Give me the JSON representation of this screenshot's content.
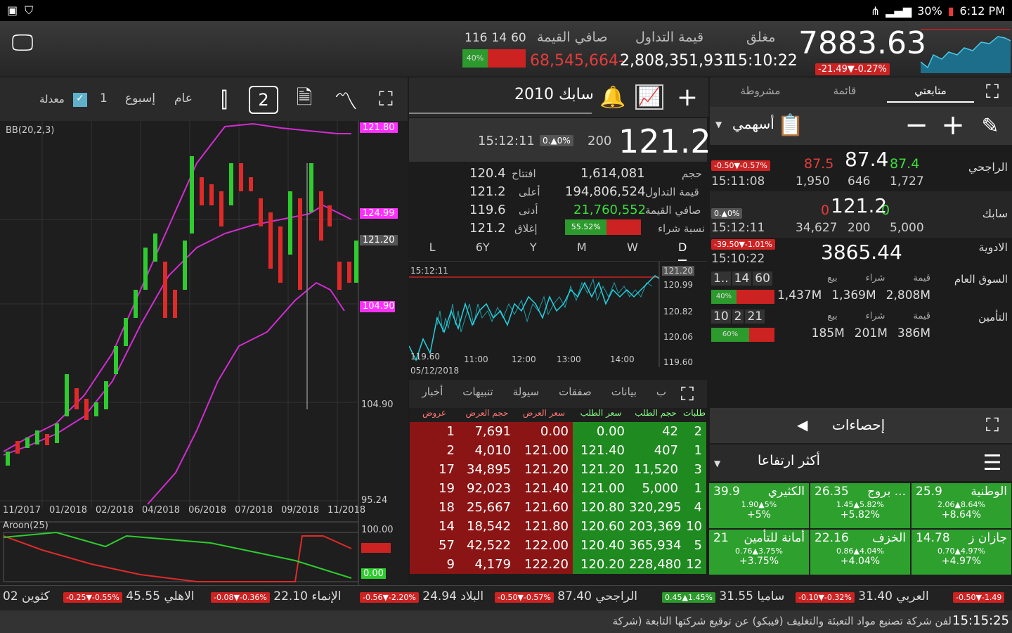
{
  "status": {
    "time": "6:12 PM",
    "battery": "30%"
  },
  "header": {
    "index_value": "7883.63",
    "index_change": "-21.49▼-0.27%",
    "labels": {
      "closed": "مغلق",
      "trade_value": "قيمة التداول",
      "net_value": "صافي القيمة"
    },
    "time": "15:10:22",
    "trade_value": "2,808,351,931",
    "net_value": "68,545,664-",
    "breadth": {
      "up": "116",
      "mid": "14",
      "down": "60",
      "pct": "40%"
    }
  },
  "chart_toolbar": {
    "adjusted": "معدلة",
    "period_n": "1",
    "period_week": "إسبوع",
    "period_year": "عام",
    "two": "2"
  },
  "main_chart": {
    "indicator": "BB(20,2,3)",
    "right_axis": [
      "121.80",
      "124.99",
      "121.20",
      "104.90",
      "95.24"
    ],
    "marker_low": "104.90 ",
    "x_labels": [
      "11/2017",
      "01/2018",
      "02/2018",
      "04/2018",
      "06/2018",
      "07/2018",
      "09/2018",
      "11/2018"
    ],
    "aroon": "Aroon(25)",
    "aroon_axis": [
      "100.00",
      "0.00"
    ]
  },
  "stock": {
    "title": "2010 سابك",
    "price": "121.2",
    "volume": "200",
    "change_badge": "0.▲0%",
    "time": "15:12:11",
    "labels": {
      "open": "افتتاح",
      "high": "أعلى",
      "low": "أدنى",
      "close": "إغلاق",
      "vol": "حجم",
      "tval": "قيمة التداول",
      "net": "صافي القيمة",
      "buy_pct": "نسبة شراء"
    },
    "open": "120.4",
    "high": "121.2",
    "low": "119.6",
    "close": "121.2",
    "vol": "1,614,081",
    "tval": "194,806,524",
    "net": "21,760,552",
    "buy_pct": "55.52%"
  },
  "intraday": {
    "periods": [
      "D",
      "W",
      "M",
      "Y",
      "6Y",
      "L"
    ],
    "time_label": "15:12:11",
    "date_label": "05/12/2018",
    "x_labels": [
      "11:00",
      "12:00",
      "13:00",
      "14:00"
    ],
    "y_labels": [
      "121.20",
      "120.99",
      "120.82",
      "120.06",
      "119.60"
    ],
    "left_low": "119.60"
  },
  "detail_tabs": [
    "ب",
    "بيانات",
    "صفقات",
    "سيولة",
    "تنبيهات",
    "أخبار"
  ],
  "orderbook": {
    "headers": [
      "طلبات",
      "حجم الطلب",
      "سعر الطلب",
      "سعر العرض",
      "حجم العرض",
      "عروض"
    ],
    "rows": [
      [
        "2",
        "42",
        "0.00",
        "0.00",
        "7,691",
        "1"
      ],
      [
        "1",
        "407",
        "121.40",
        "121.00",
        "4,010",
        "2"
      ],
      [
        "3",
        "11,520",
        "121.20",
        "121.20",
        "34,895",
        "17"
      ],
      [
        "1",
        "5,000",
        "121.00",
        "121.40",
        "92,023",
        "19"
      ],
      [
        "4",
        "320,295",
        "120.80",
        "121.60",
        "25,667",
        "18"
      ],
      [
        "10",
        "203,369",
        "120.60",
        "121.80",
        "18,542",
        "14"
      ],
      [
        "5",
        "365,934",
        "120.40",
        "122.00",
        "42,522",
        "57"
      ],
      [
        "12",
        "228,480",
        "120.20",
        "122.20",
        "4,179",
        "9"
      ]
    ]
  },
  "watch_tabs": [
    "متابعتي",
    "قائمة",
    "مشروطة"
  ],
  "watch_group": "أسهمي",
  "watch": [
    {
      "name": "الراجحي",
      "price": "87.4",
      "bid": "87.4",
      "ask": "87.5",
      "change": "-0.50▼-0.57%",
      "time": "15:11:08",
      "v1": "1,727",
      "v2": "646",
      "v3": "1,950"
    },
    {
      "name": "سابك",
      "price": "121.2",
      "bid": "0",
      "ask": "0",
      "change": "0.▲0%",
      "time": "15:12:11",
      "v1": "5,000",
      "v2": "200",
      "v3": "34,627"
    },
    {
      "name": "الادوية",
      "price": "3865.44",
      "change": "-39.50▼-1.01%",
      "time": "15:10:22"
    }
  ],
  "sectors": [
    {
      "name": "السوق العام",
      "labels": [
        "قيمة",
        "شراء",
        "بيع"
      ],
      "b": [
        "1..",
        "14",
        "60"
      ],
      "pct": "40%",
      "vals": [
        "2,808M",
        "1,369M",
        "1,437M"
      ]
    },
    {
      "name": "التأمين",
      "labels": [
        "قيمة",
        "شراء",
        "بيع"
      ],
      "b": [
        "10",
        "2",
        "21"
      ],
      "pct": "60%",
      "vals": [
        "386M",
        "201M",
        "185M"
      ]
    }
  ],
  "stats": {
    "title": "إحصاءات",
    "sub": "أكثر ارتفاعا",
    "cells": [
      {
        "name": "الوطنية",
        "price": "25.9",
        "chg": "2.06▲8.64%",
        "pct": "+8.64%"
      },
      {
        "name": "بروج ...",
        "price": "26.35",
        "chg": "1.45▲5.82%",
        "pct": "+5.82%"
      },
      {
        "name": "الكثيري",
        "price": "39.9",
        "chg": "1.90▲5%",
        "pct": "+5%"
      },
      {
        "name": "جازان ز",
        "price": "14.78",
        "chg": "0.70▲4.97%",
        "pct": "+4.97%"
      },
      {
        "name": "الخزف",
        "price": "22.16",
        "chg": "0.86▲4.04%",
        "pct": "+4.04%"
      },
      {
        "name": "أمانة للتأمين",
        "price": "21",
        "chg": "0.76▲3.75%",
        "pct": "+3.75%"
      }
    ]
  },
  "ticker": [
    {
      "name": "كثوين 02",
      "chg": "",
      "side": "none"
    },
    {
      "name": "الاهلي 45.55",
      "chg": "-0.25▼-0.55%",
      "side": "red"
    },
    {
      "name": "الإنماء 22.10",
      "chg": "-0.08▼-0.36%",
      "side": "red"
    },
    {
      "name": "البلاد 24.94",
      "chg": "-0.56▼-2.20%",
      "side": "red"
    },
    {
      "name": "الراجحي 87.40",
      "chg": "-0.50▼-0.57%",
      "side": "red"
    },
    {
      "name": "ساميا 31.55",
      "chg": "0.45▲1.45%",
      "side": "green"
    },
    {
      "name": "العربي 31.40",
      "chg": "-0.10▼-0.32%",
      "side": "red"
    },
    {
      "name": "",
      "chg": "-0.50▼-1.49",
      "side": "red"
    }
  ],
  "news": {
    "time": "15:15:25",
    "text": "لفن شركة تصنيع مواد التعبئة والتغليف (فيبكو) عن توقيع شركتها التابعة (شركة"
  }
}
